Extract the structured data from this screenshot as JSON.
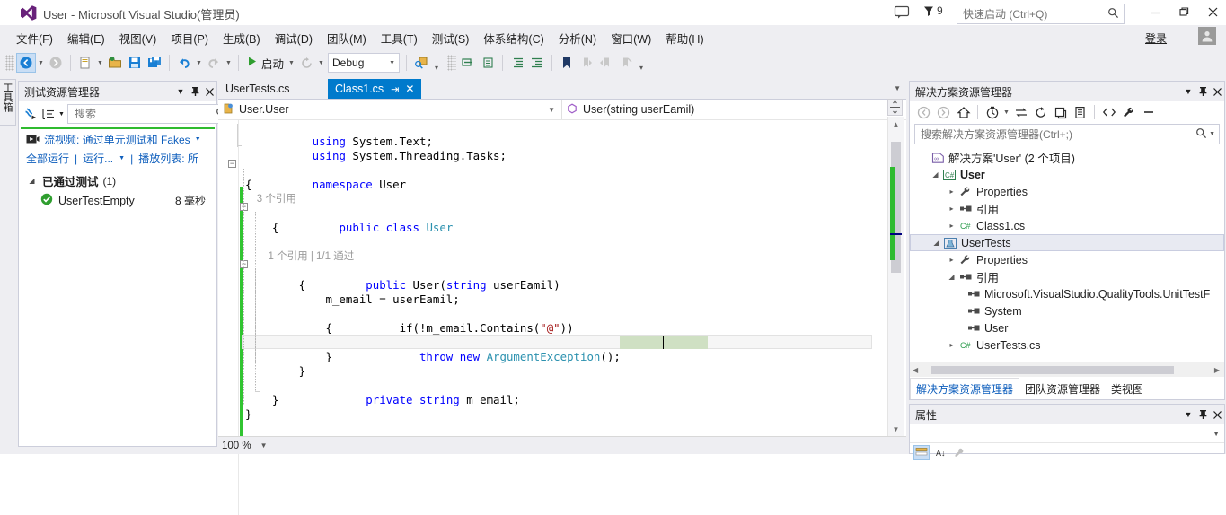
{
  "window": {
    "title": "User - Microsoft Visual Studio(管理员)",
    "signin": "登录",
    "notification_count": "9",
    "quick_launch_placeholder": "快速启动 (Ctrl+Q)",
    "minimize": "—",
    "maximize": "❐",
    "close": "✕"
  },
  "menu": [
    {
      "label": "文件(F)"
    },
    {
      "label": "编辑(E)"
    },
    {
      "label": "视图(V)"
    },
    {
      "label": "项目(P)"
    },
    {
      "label": "生成(B)"
    },
    {
      "label": "调试(D)"
    },
    {
      "label": "团队(M)"
    },
    {
      "label": "工具(T)"
    },
    {
      "label": "测试(S)"
    },
    {
      "label": "体系结构(C)"
    },
    {
      "label": "分析(N)"
    },
    {
      "label": "窗口(W)"
    },
    {
      "label": "帮助(H)"
    }
  ],
  "toolbar": {
    "start_label": "启动",
    "config_value": "Debug",
    "overflow": "▾"
  },
  "vertical_tab": {
    "label": "工具箱"
  },
  "test_explorer": {
    "title": "测试资源管理器",
    "search_placeholder": "搜索",
    "stream_link": "流视频: 通过单元测试和 Fakes",
    "run_all": "全部运行",
    "run": "运行...",
    "playlist": "播放列表: 所",
    "group_label": "已通过测试",
    "group_count": "(1)",
    "tests": [
      {
        "name": "UserTestEmpty",
        "duration": "8 毫秒",
        "status": "passed"
      }
    ]
  },
  "editor": {
    "tabs": [
      {
        "label": "UserTests.cs",
        "active": false
      },
      {
        "label": "Class1.cs",
        "active": true
      }
    ],
    "tab_pin": "↵",
    "tab_close": "✕",
    "nav_left": "User.User",
    "nav_right": "User(string userEamil)",
    "zoom": "100 %",
    "code_lines": [
      {
        "indent": 0,
        "parts": [
          {
            "t": "k",
            "v": "using"
          },
          {
            "t": "p",
            "v": " System.Text;"
          }
        ]
      },
      {
        "indent": 0,
        "parts": [
          {
            "t": "k",
            "v": "using"
          },
          {
            "t": "p",
            "v": " System.Threading.Tasks;"
          }
        ]
      },
      {
        "indent": 0,
        "parts": []
      },
      {
        "indent": 0,
        "parts": [
          {
            "t": "k",
            "v": "namespace"
          },
          {
            "t": "p",
            "v": " User"
          }
        ]
      },
      {
        "indent": 0,
        "parts": [
          {
            "t": "p",
            "v": "{"
          }
        ]
      },
      {
        "indent": 0,
        "parts": [
          {
            "t": "lens",
            "v": "    3 个引用"
          }
        ]
      },
      {
        "indent": 0,
        "parts": [
          {
            "t": "p",
            "v": "    "
          },
          {
            "t": "k",
            "v": "public class"
          },
          {
            "t": "p",
            "v": " "
          },
          {
            "t": "t",
            "v": "User"
          }
        ]
      },
      {
        "indent": 0,
        "parts": [
          {
            "t": "p",
            "v": "    {"
          }
        ]
      },
      {
        "indent": 0,
        "parts": []
      },
      {
        "indent": 0,
        "parts": [
          {
            "t": "lens",
            "v": "        1 个引用 | 1/1 通过"
          }
        ]
      },
      {
        "indent": 0,
        "parts": [
          {
            "t": "p",
            "v": "        "
          },
          {
            "t": "k",
            "v": "public"
          },
          {
            "t": "p",
            "v": " User("
          },
          {
            "t": "k",
            "v": "string"
          },
          {
            "t": "p",
            "v": " userEamil)"
          }
        ]
      },
      {
        "indent": 0,
        "parts": [
          {
            "t": "p",
            "v": "        {"
          }
        ]
      },
      {
        "indent": 0,
        "parts": [
          {
            "t": "p",
            "v": "            m_email = userEamil;"
          }
        ]
      },
      {
        "indent": 0,
        "parts": [
          {
            "t": "p",
            "v": "             if(!m_email.Contains("
          },
          {
            "t": "s",
            "v": "\"@\""
          },
          {
            "t": "p",
            "v": "))"
          }
        ]
      },
      {
        "indent": 0,
        "parts": [
          {
            "t": "p",
            "v": "            {"
          }
        ]
      },
      {
        "indent": 0,
        "parts": [
          {
            "t": "p",
            "v": "                "
          },
          {
            "t": "k",
            "v": "throw new"
          },
          {
            "t": "p",
            "v": " "
          },
          {
            "t": "t",
            "v": "ArgumentException"
          },
          {
            "t": "p",
            "v": "();"
          }
        ]
      },
      {
        "indent": 0,
        "parts": [
          {
            "t": "p",
            "v": "            }"
          }
        ]
      },
      {
        "indent": 0,
        "parts": [
          {
            "t": "p",
            "v": "        }"
          }
        ]
      },
      {
        "indent": 0,
        "parts": [
          {
            "t": "p",
            "v": "        "
          },
          {
            "t": "k",
            "v": "private string"
          },
          {
            "t": "p",
            "v": " m_email;"
          }
        ]
      },
      {
        "indent": 0,
        "parts": [
          {
            "t": "p",
            "v": "    }"
          }
        ]
      },
      {
        "indent": 0,
        "parts": [
          {
            "t": "p",
            "v": "}"
          }
        ]
      }
    ]
  },
  "solution_explorer": {
    "title": "解决方案资源管理器",
    "search_placeholder": "搜索解决方案资源管理器(Ctrl+;)",
    "tree": [
      {
        "depth": 0,
        "tri": "none",
        "icon": "solution-icon",
        "label": "解决方案'User' (2 个项目)",
        "bold": false,
        "selected": false
      },
      {
        "depth": 1,
        "tri": "open",
        "icon": "csharp-project-icon",
        "label": "User",
        "bold": true,
        "selected": false
      },
      {
        "depth": 2,
        "tri": "closed",
        "icon": "wrench-icon",
        "label": "Properties",
        "bold": false,
        "selected": false
      },
      {
        "depth": 2,
        "tri": "closed",
        "icon": "references-icon",
        "label": "引用",
        "bold": false,
        "selected": false
      },
      {
        "depth": 2,
        "tri": "closed",
        "icon": "csharp-file-icon",
        "label": "Class1.cs",
        "bold": false,
        "selected": false
      },
      {
        "depth": 1,
        "tri": "open",
        "icon": "test-project-icon",
        "label": "UserTests",
        "bold": false,
        "selected": true
      },
      {
        "depth": 2,
        "tri": "closed",
        "icon": "wrench-icon",
        "label": "Properties",
        "bold": false,
        "selected": false
      },
      {
        "depth": 2,
        "tri": "open",
        "icon": "references-icon",
        "label": "引用",
        "bold": false,
        "selected": false
      },
      {
        "depth": 3,
        "tri": "none",
        "icon": "reference-icon",
        "label": "Microsoft.VisualStudio.QualityTools.UnitTestF",
        "bold": false,
        "selected": false
      },
      {
        "depth": 3,
        "tri": "none",
        "icon": "reference-icon",
        "label": "System",
        "bold": false,
        "selected": false
      },
      {
        "depth": 3,
        "tri": "none",
        "icon": "reference-icon",
        "label": "User",
        "bold": false,
        "selected": false
      },
      {
        "depth": 2,
        "tri": "closed",
        "icon": "csharp-file-icon",
        "label": "UserTests.cs",
        "bold": false,
        "selected": false
      }
    ],
    "tabs": [
      {
        "label": "解决方案资源管理器",
        "active": true
      },
      {
        "label": "团队资源管理器",
        "active": false
      },
      {
        "label": "类视图",
        "active": false
      }
    ]
  },
  "properties": {
    "title": "属性"
  },
  "colors": {
    "accent_blue": "#007acc",
    "link_blue": "#0f5fbd",
    "pass_green": "#2fbb2f",
    "keyword_blue": "#0000ff",
    "type_teal": "#2b91af",
    "string_red": "#a31515",
    "chrome_bg": "#eeeef2"
  }
}
